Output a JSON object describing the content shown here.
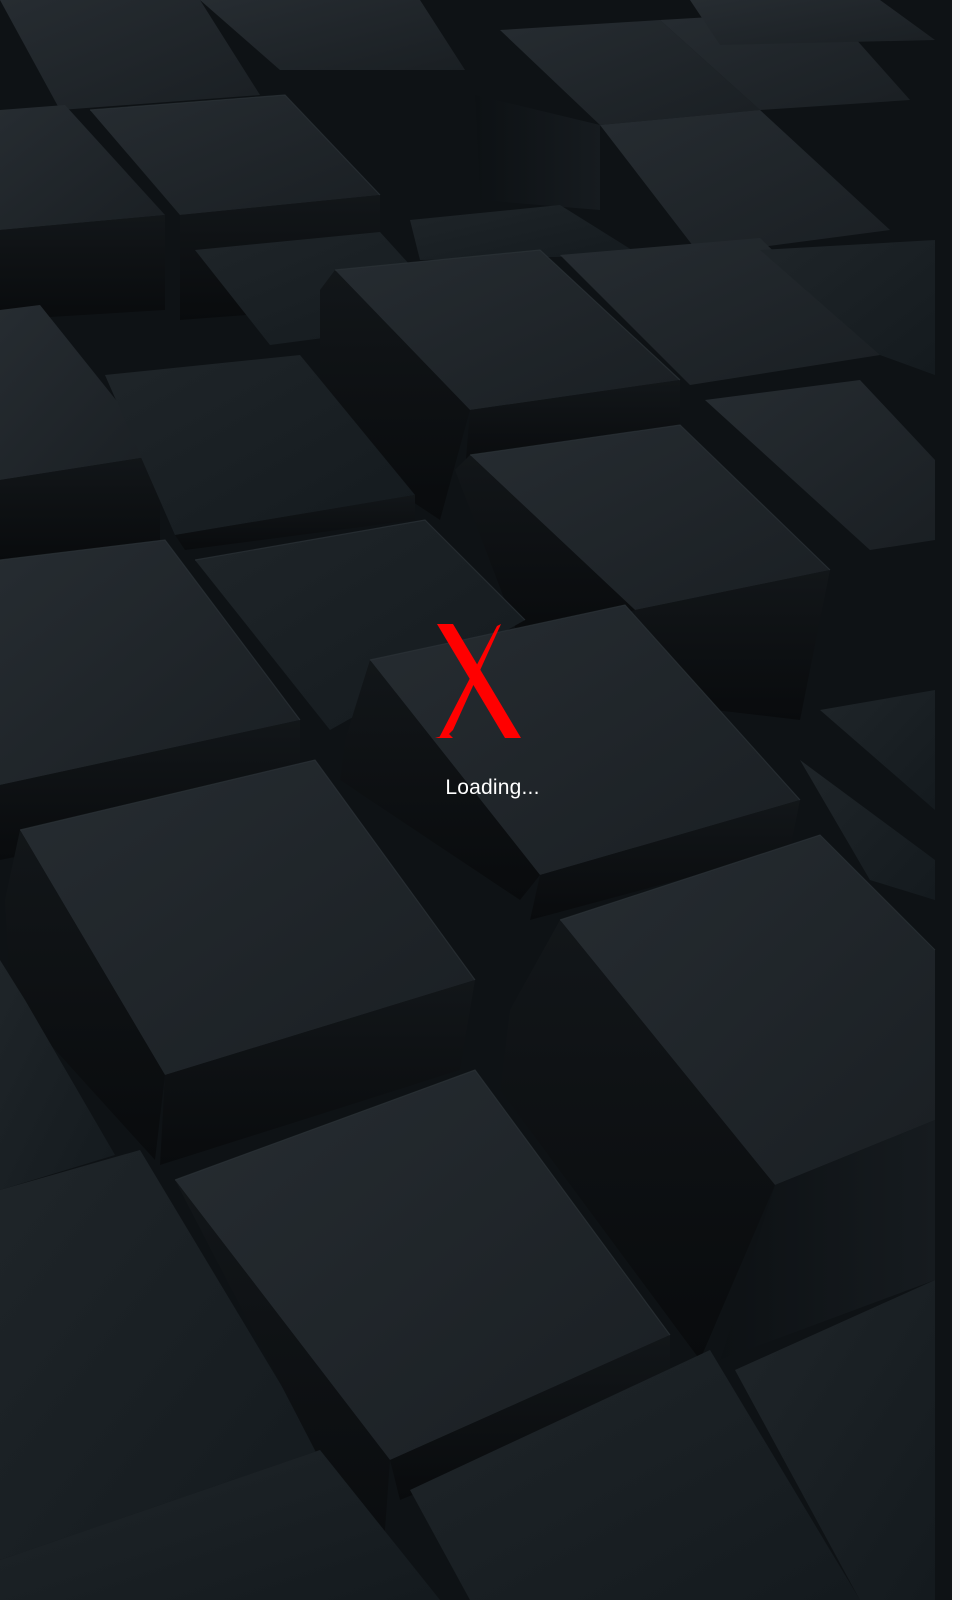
{
  "splash": {
    "loading_text": "Loading...",
    "logo_icon": "red-x-logo"
  },
  "colors": {
    "logo": "#ff0000",
    "text": "#ffffff",
    "background": "#121619",
    "cube_face": "#1b2126"
  }
}
